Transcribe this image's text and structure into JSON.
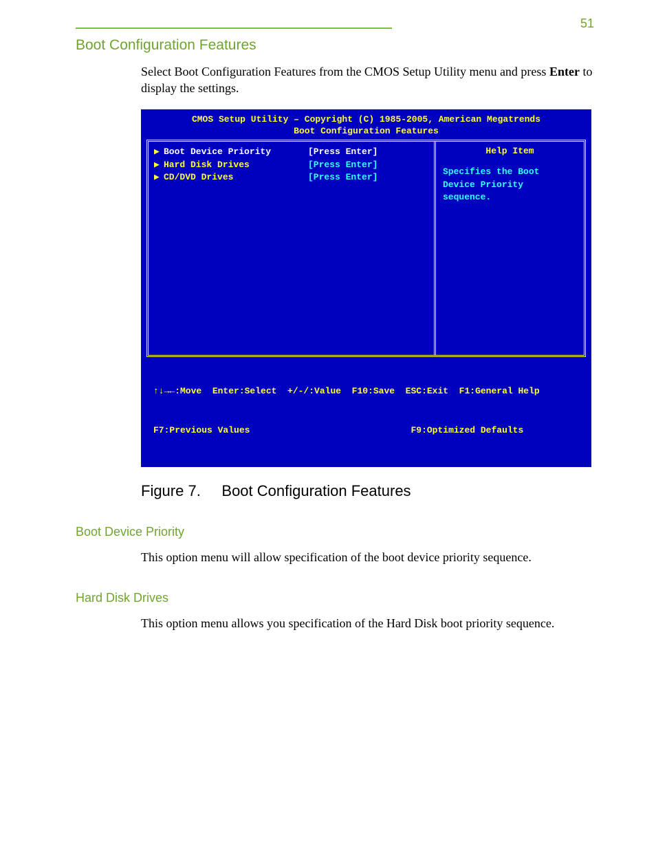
{
  "header": {
    "section": "Boot Configuration Features",
    "pageNumber": "51"
  },
  "intro": {
    "line1": "Select Boot Configuration Features from the CMOS Setup Utility menu and press ",
    "enter": "Enter",
    "line2": " to display the settings."
  },
  "bios": {
    "titleLine1": "CMOS Setup Utility – Copyright (C) 1985-2005, American Megatrends",
    "titleLine2": "Boot Configuration Features",
    "items": [
      {
        "arrow": "▶",
        "name": "Boot Device Priority",
        "value": "[Press Enter]",
        "selected": true
      },
      {
        "arrow": "▶",
        "name": "Hard Disk Drives",
        "value": "[Press Enter]",
        "selected": false
      },
      {
        "arrow": "▶",
        "name": "CD/DVD Drives",
        "value": "[Press Enter]",
        "selected": false
      }
    ],
    "help": {
      "title": "Help Item",
      "text": "Specifies the Boot Device Priority sequence."
    },
    "footer1": "↑↓→←:Move  Enter:Select  +/-/:Value  F10:Save  ESC:Exit  F1:General Help",
    "footer2": "F7:Previous Values                              F9:Optimized Defaults"
  },
  "figure": {
    "label": "Figure 7.",
    "title": "Boot Configuration Features"
  },
  "sections": [
    {
      "heading": "Boot Device Priority",
      "text": "This option menu will allow specification of the boot device priority sequence."
    },
    {
      "heading": "Hard Disk Drives",
      "text": "This option menu allows you specification of the Hard Disk boot priority sequence."
    }
  ]
}
